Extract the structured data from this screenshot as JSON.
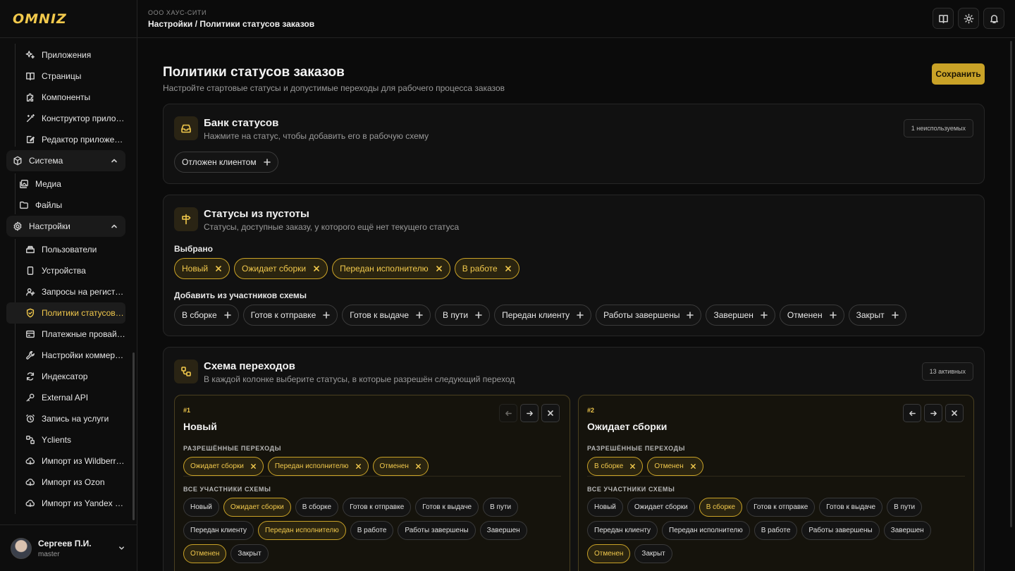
{
  "brand": "OMNIZ",
  "sidebar": {
    "items_top": [
      {
        "label": "Приложения",
        "icon": "sparkles-icon"
      },
      {
        "label": "Страницы",
        "icon": "book-icon"
      },
      {
        "label": "Компоненты",
        "icon": "puzzle-icon"
      },
      {
        "label": "Конструктор приложений",
        "icon": "wand-icon"
      },
      {
        "label": "Редактор приложений",
        "icon": "edit-icon"
      }
    ],
    "group_system": {
      "label": "Система"
    },
    "items_system": [
      {
        "label": "Медиа",
        "icon": "images-icon"
      },
      {
        "label": "Файлы",
        "icon": "folder-icon"
      }
    ],
    "group_settings": {
      "label": "Настройки"
    },
    "items_settings": [
      {
        "label": "Пользователи",
        "icon": "users-icon"
      },
      {
        "label": "Устройства",
        "icon": "device-icon"
      },
      {
        "label": "Запросы на регистрацию",
        "icon": "user-plus-icon"
      },
      {
        "label": "Политики статусов заказов",
        "icon": "shield-icon"
      },
      {
        "label": "Платежные провайдеры",
        "icon": "wallet-icon"
      },
      {
        "label": "Настройки коммерции",
        "icon": "wrench-icon"
      },
      {
        "label": "Индексатор",
        "icon": "refresh-icon"
      },
      {
        "label": "External API",
        "icon": "key-icon"
      },
      {
        "label": "Запись на услуги",
        "icon": "alarm-icon"
      },
      {
        "label": "Yclients",
        "icon": "link-icon"
      },
      {
        "label": "Импорт из Wildberries",
        "icon": "cloud-icon"
      },
      {
        "label": "Импорт из Ozon",
        "icon": "cloud-icon"
      },
      {
        "label": "Импорт из Yandex Market",
        "icon": "cloud-icon"
      }
    ],
    "user": {
      "name": "Сергеев П.И.",
      "role": "master"
    }
  },
  "header": {
    "org": "ООО ХАУС-СИТИ",
    "breadcrumb": "Настройки / Политики статусов заказов"
  },
  "page": {
    "title": "Политики статусов заказов",
    "subtitle": "Настройте стартовые статусы и допустимые переходы для рабочего процесса заказов",
    "save_label": "Сохранить"
  },
  "bank": {
    "title": "Банк статусов",
    "subtitle": "Нажмите на статус, чтобы добавить его в рабочую схему",
    "badge": "1 неиспользуемых",
    "chips": [
      "Отложен клиентом"
    ]
  },
  "initial": {
    "title": "Статусы из пустоты",
    "subtitle": "Статусы, доступные заказу, у которого ещё нет текущего статуса",
    "selected_label": "Выбрано",
    "selected": [
      "Новый",
      "Ожидает сборки",
      "Передан исполнителю",
      "В работе"
    ],
    "add_label": "Добавить из участников схемы",
    "available": [
      "В сборке",
      "Готов к отправке",
      "Готов к выдаче",
      "В пути",
      "Передан клиенту",
      "Работы завершены",
      "Завершен",
      "Отменен",
      "Закрыт"
    ]
  },
  "scheme": {
    "title": "Схема переходов",
    "subtitle": "В каждой колонке выберите статусы, в которые разрешён следующий переход",
    "badge": "13 активных",
    "allowed_label": "РАЗРЕШЁННЫЕ ПЕРЕХОДЫ",
    "members_label": "ВСЕ УЧАСТНИКИ СХЕМЫ",
    "columns": [
      {
        "num": "#1",
        "title": "Новый",
        "allowed": [
          "Ожидает сборки",
          "Передан исполнителю",
          "Отменен"
        ],
        "members": [
          {
            "label": "Новый",
            "selected": false
          },
          {
            "label": "Ожидает сборки",
            "selected": true
          },
          {
            "label": "В сборке",
            "selected": false
          },
          {
            "label": "Готов к отправке",
            "selected": false
          },
          {
            "label": "Готов к выдаче",
            "selected": false
          },
          {
            "label": "В пути",
            "selected": false
          },
          {
            "label": "Передан клиенту",
            "selected": false
          },
          {
            "label": "Передан исполнителю",
            "selected": true
          },
          {
            "label": "В работе",
            "selected": false
          },
          {
            "label": "Работы завершены",
            "selected": false
          },
          {
            "label": "Завершен",
            "selected": false
          },
          {
            "label": "Отменен",
            "selected": true
          },
          {
            "label": "Закрыт",
            "selected": false
          }
        ]
      },
      {
        "num": "#2",
        "title": "Ожидает сборки",
        "allowed": [
          "В сборке",
          "Отменен"
        ],
        "members": [
          {
            "label": "Новый",
            "selected": false
          },
          {
            "label": "Ожидает сборки",
            "selected": false
          },
          {
            "label": "В сборке",
            "selected": true
          },
          {
            "label": "Готов к отправке",
            "selected": false
          },
          {
            "label": "Готов к выдаче",
            "selected": false
          },
          {
            "label": "В пути",
            "selected": false
          },
          {
            "label": "Передан клиенту",
            "selected": false
          },
          {
            "label": "Передан исполнителю",
            "selected": false
          },
          {
            "label": "В работе",
            "selected": false
          },
          {
            "label": "Работы завершены",
            "selected": false
          },
          {
            "label": "Завершен",
            "selected": false
          },
          {
            "label": "Отменен",
            "selected": true
          },
          {
            "label": "Закрыт",
            "selected": false
          }
        ]
      }
    ]
  },
  "colors": {
    "accent": "#f2c94c",
    "accent_bg": "#2a2410",
    "save_bg": "#c9a227"
  }
}
